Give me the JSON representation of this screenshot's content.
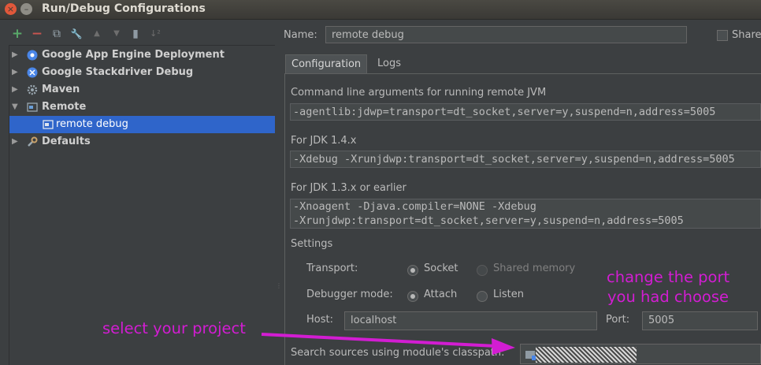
{
  "window": {
    "title": "Run/Debug Configurations",
    "close_glyph": "×",
    "min_glyph": "–"
  },
  "toolbar": {
    "add": "+",
    "remove": "−",
    "copy": "⧉",
    "edit_defaults": "🔧",
    "move_up": "▲",
    "move_down": "▼",
    "folder": "▮",
    "sort": "↓²"
  },
  "tree": {
    "items": [
      {
        "label": "Google App Engine Deployment",
        "arrow": "▶",
        "icon": "app-engine-icon"
      },
      {
        "label": "Google Stackdriver Debug",
        "arrow": "▶",
        "icon": "stackdriver-icon"
      },
      {
        "label": "Maven",
        "arrow": "▶",
        "icon": "maven-gear-icon"
      },
      {
        "label": "Remote",
        "arrow": "▼",
        "icon": "remote-icon"
      },
      {
        "label": "remote debug",
        "arrow": "",
        "icon": "remote-config-icon"
      },
      {
        "label": "Defaults",
        "arrow": "▶",
        "icon": "wrench-icon"
      }
    ]
  },
  "form": {
    "name_label": "Name:",
    "name_value": "remote debug",
    "share_label": "Share",
    "tabs": [
      "Configuration",
      "Logs"
    ],
    "cmd_label": "Command line arguments for running remote JVM",
    "cmd_value": "-agentlib:jdwp=transport=dt_socket,server=y,suspend=n,address=5005",
    "jdk14_label": "For JDK 1.4.x",
    "jdk14_value": "-Xdebug -Xrunjdwp:transport=dt_socket,server=y,suspend=n,address=5005",
    "jdk13_label": "For JDK 1.3.x or earlier",
    "jdk13_line1": "-Xnoagent -Djava.compiler=NONE -Xdebug",
    "jdk13_line2": "-Xrunjdwp:transport=dt_socket,server=y,suspend=n,address=5005",
    "settings_label": "Settings",
    "transport_label": "Transport:",
    "transport_socket": "Socket",
    "transport_shared": "Shared memory",
    "debugger_mode_label": "Debugger mode:",
    "mode_attach": "Attach",
    "mode_listen": "Listen",
    "host_label": "Host:",
    "host_value": "localhost",
    "port_label": "Port:",
    "port_value": "5005",
    "search_sources_label": "Search sources using module's classpath:"
  },
  "annotations": {
    "port_line1": "change the port",
    "port_line2": "you had choose",
    "project": "select your project",
    "color": "#d21dd2"
  }
}
